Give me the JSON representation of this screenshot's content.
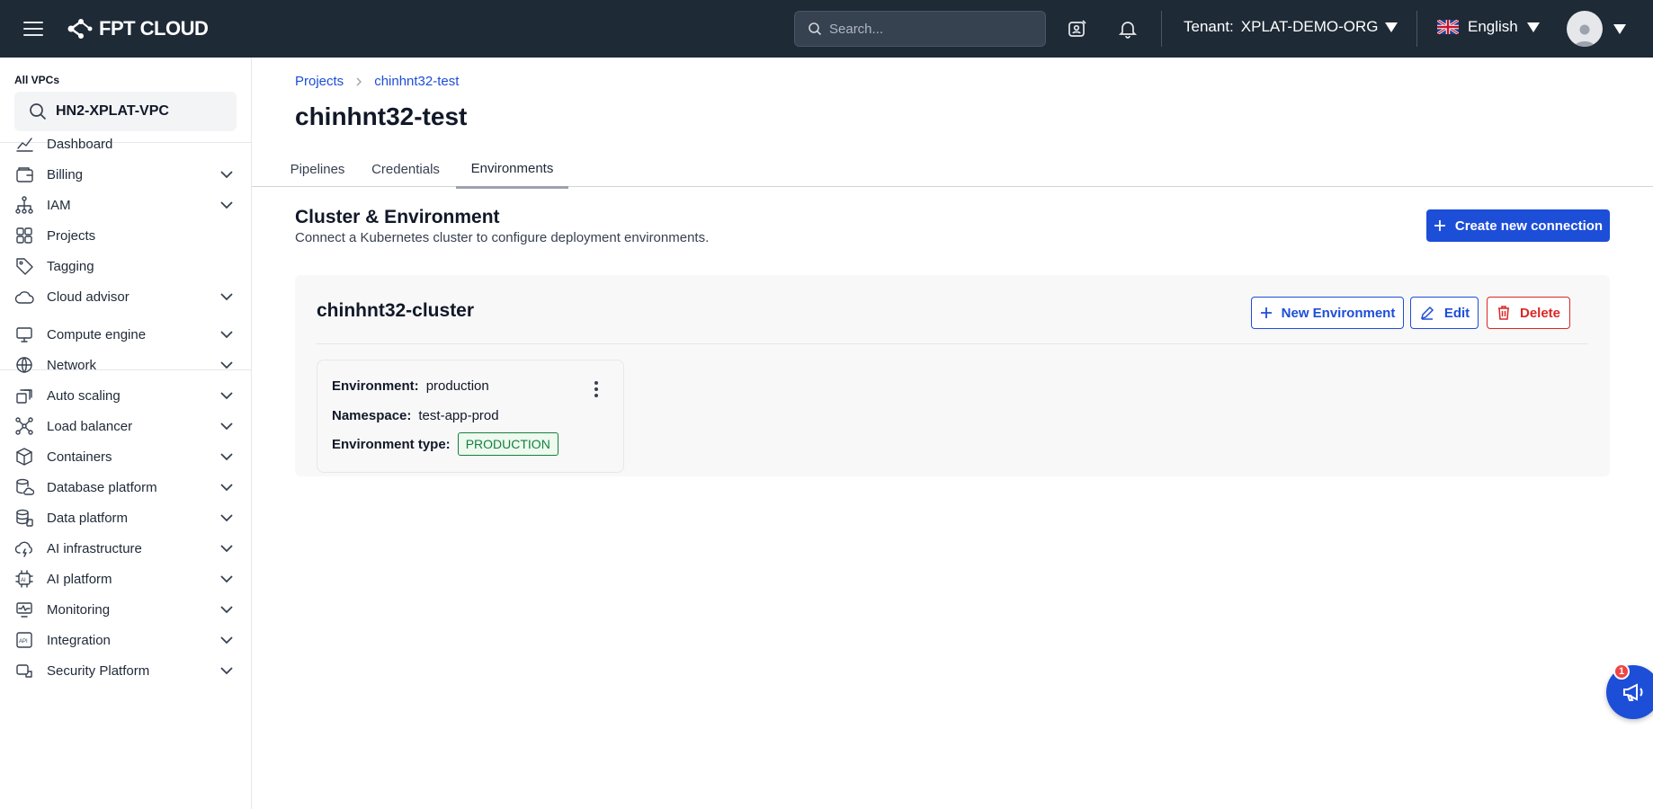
{
  "header": {
    "brand": "FPT CLOUD",
    "search_placeholder": "Search...",
    "tenant_label": "Tenant:",
    "tenant_value": "XPLAT-DEMO-ORG",
    "language": "English"
  },
  "sidebar": {
    "vpc_label": "All VPCs",
    "vpc_value": "HN2-XPLAT-VPC",
    "items": [
      {
        "label": "Dashboard",
        "icon": "chart-line-icon",
        "expandable": false
      },
      {
        "label": "Billing",
        "icon": "wallet-icon",
        "expandable": true
      },
      {
        "label": "IAM",
        "icon": "hierarchy-icon",
        "expandable": true
      },
      {
        "label": "Projects",
        "icon": "grid-icon",
        "expandable": false
      },
      {
        "label": "Tagging",
        "icon": "tag-icon",
        "expandable": false
      },
      {
        "label": "Cloud advisor",
        "icon": "cloud-icon",
        "expandable": true
      },
      {
        "label": "Compute engine",
        "icon": "monitor-icon",
        "expandable": true
      },
      {
        "label": "Network",
        "icon": "globe-icon",
        "expandable": true
      },
      {
        "label": "Auto scaling",
        "icon": "scaling-icon",
        "expandable": true
      },
      {
        "label": "Load balancer",
        "icon": "network-nodes-icon",
        "expandable": true
      },
      {
        "label": "Containers",
        "icon": "box-icon",
        "expandable": true
      },
      {
        "label": "Database platform",
        "icon": "database-cloud-icon",
        "expandable": true
      },
      {
        "label": "Data platform",
        "icon": "database-stack-icon",
        "expandable": true
      },
      {
        "label": "AI infrastructure",
        "icon": "cloud-bolt-icon",
        "expandable": true
      },
      {
        "label": "AI platform",
        "icon": "ai-chip-icon",
        "expandable": true
      },
      {
        "label": "Monitoring",
        "icon": "monitor-pulse-icon",
        "expandable": true
      },
      {
        "label": "Integration",
        "icon": "api-icon",
        "expandable": true
      },
      {
        "label": "Security Platform",
        "icon": "security-icon",
        "expandable": true
      }
    ]
  },
  "breadcrumb": {
    "items": [
      "Projects",
      "chinhnt32-test"
    ]
  },
  "page": {
    "title": "chinhnt32-test",
    "tabs": [
      "Pipelines",
      "Credentials",
      "Environments"
    ],
    "active_tab": "Environments"
  },
  "section": {
    "title": "Cluster & Environment",
    "subtitle": "Connect a Kubernetes cluster to configure deployment environments.",
    "create_button": "Create new connection"
  },
  "cluster": {
    "name": "chinhnt32-cluster",
    "new_env_button": "New Environment",
    "edit_button": "Edit",
    "delete_button": "Delete",
    "environments": [
      {
        "env_label": "Environment:",
        "env_value": "production",
        "ns_label": "Namespace:",
        "ns_value": "test-app-prod",
        "type_label": "Environment type:",
        "type_value": "PRODUCTION"
      }
    ]
  },
  "notifications": {
    "announcement_count": "1"
  },
  "colors": {
    "topbar": "#1e2a36",
    "primary": "#1d4ed8",
    "danger": "#dc2626",
    "success": "#15803d"
  }
}
